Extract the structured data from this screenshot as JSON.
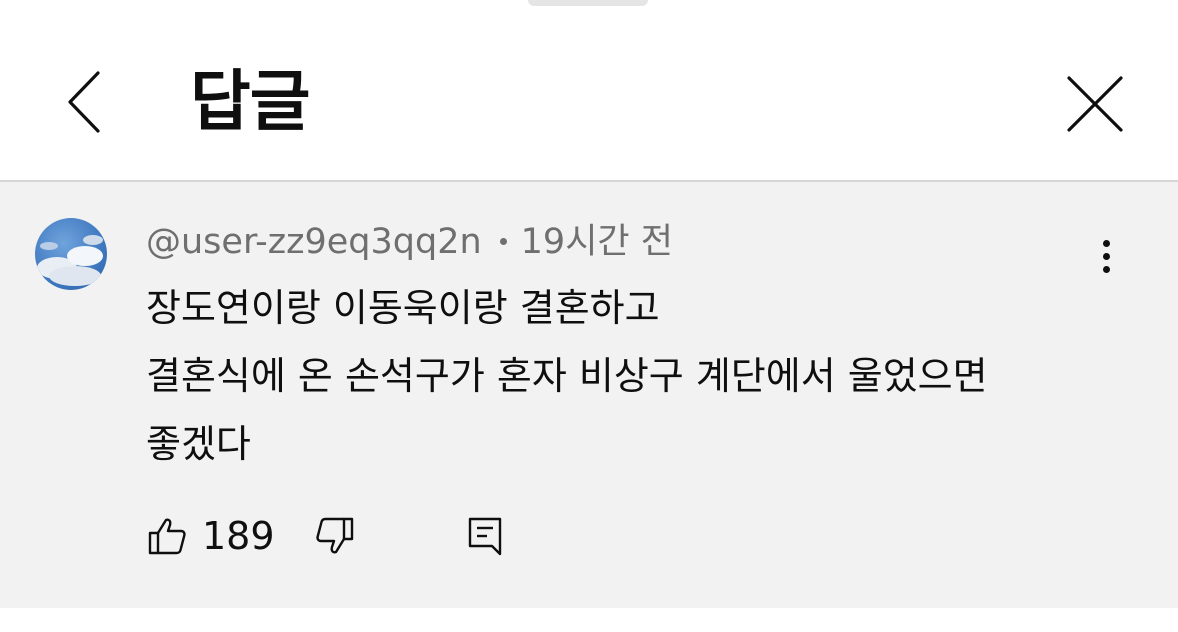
{
  "header": {
    "title": "답글",
    "back_icon": "chevron-left-icon",
    "close_icon": "close-icon"
  },
  "comment": {
    "author": "@user-zz9eq3qq2n",
    "time": "19시간 전",
    "lines": [
      "장도연이랑 이동욱이랑 결혼하고",
      "결혼식에 온 손석구가 혼자 비상구 계단에서 울었으면",
      "좋겠다"
    ],
    "likes": "189",
    "more_icon": "more-vertical-icon",
    "like_icon": "thumbs-up-icon",
    "dislike_icon": "thumbs-down-icon",
    "reply_icon": "reply-icon"
  },
  "colors": {
    "comment_background": "#f2f2f2",
    "text_primary": "#0f0f0f",
    "text_secondary": "#6f6f6f"
  }
}
